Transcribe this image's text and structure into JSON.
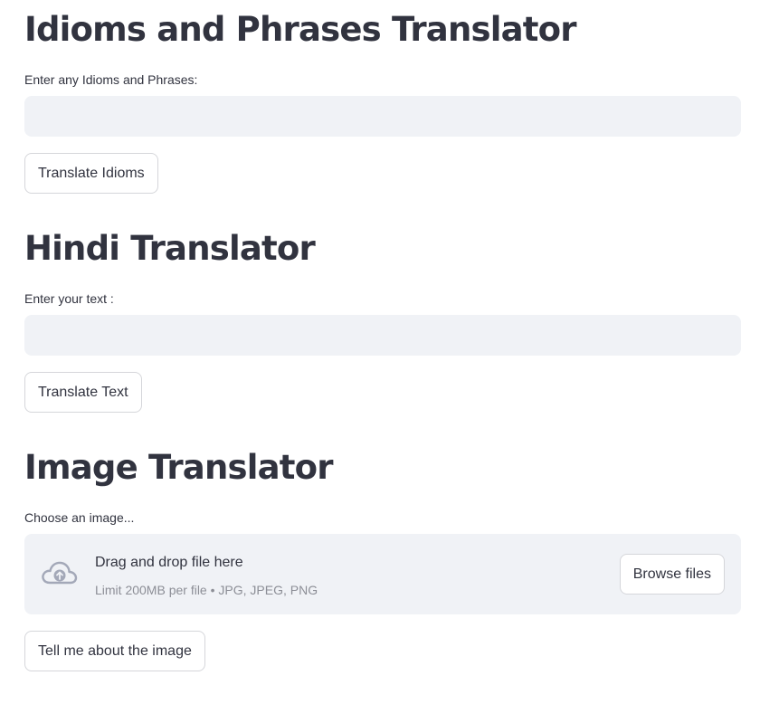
{
  "idioms": {
    "title": "Idioms and Phrases Translator",
    "input_label": "Enter any Idioms and Phrases:",
    "input_value": "",
    "button_label": "Translate Idioms"
  },
  "hindi": {
    "title": "Hindi Translator",
    "input_label": "Enter your text :",
    "input_value": "",
    "button_label": "Translate Text"
  },
  "image": {
    "title": "Image Translator",
    "uploader_label": "Choose an image...",
    "drop_text": "Drag and drop file here",
    "limit_text": "Limit 200MB per file • JPG, JPEG, PNG",
    "browse_label": "Browse files",
    "upload_icon": "cloud-upload-icon",
    "button_label": "Tell me about the image"
  },
  "colors": {
    "text": "#31333f",
    "input_bg": "#f0f2f6",
    "muted": "#8c8e96",
    "icon": "#a3a8b8"
  }
}
